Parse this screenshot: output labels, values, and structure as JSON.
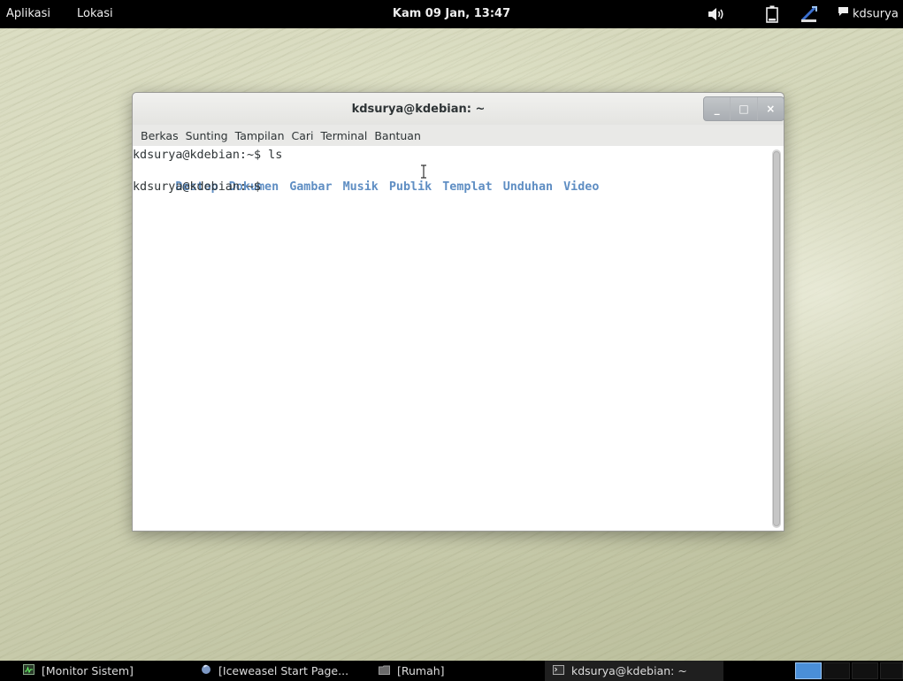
{
  "top_panel": {
    "applications": "Aplikasi",
    "places": "Lokasi",
    "clock": "Kam 09 Jan, 13:47",
    "user": "kdsurya",
    "icons": [
      "volume-icon",
      "battery-icon",
      "network-icon",
      "chat-icon"
    ]
  },
  "terminal": {
    "title": "kdsurya@kdebian: ~",
    "buttons": {
      "minimize": "_",
      "maximize": "□",
      "close": "×"
    },
    "menus": [
      "Berkas",
      "Sunting",
      "Tampilan",
      "Cari",
      "Terminal",
      "Bantuan"
    ],
    "prompt1": "kdsurya@kdebian:~$ ls",
    "dirs": [
      "Destop",
      "Dokumen",
      "Gambar",
      "Musik",
      "Publik",
      "Templat",
      "Unduhan",
      "Video"
    ],
    "prompt2": "kdsurya@kdebian:~$",
    "dir_color": "#5f8ec3"
  },
  "taskbar": {
    "items": [
      "[Monitor Sistem]",
      "[Iceweasel Start Page...",
      "[Rumah]",
      "kdsurya@kdebian: ~"
    ],
    "active_index": 3,
    "workspace_color": "#4a8fd8"
  }
}
